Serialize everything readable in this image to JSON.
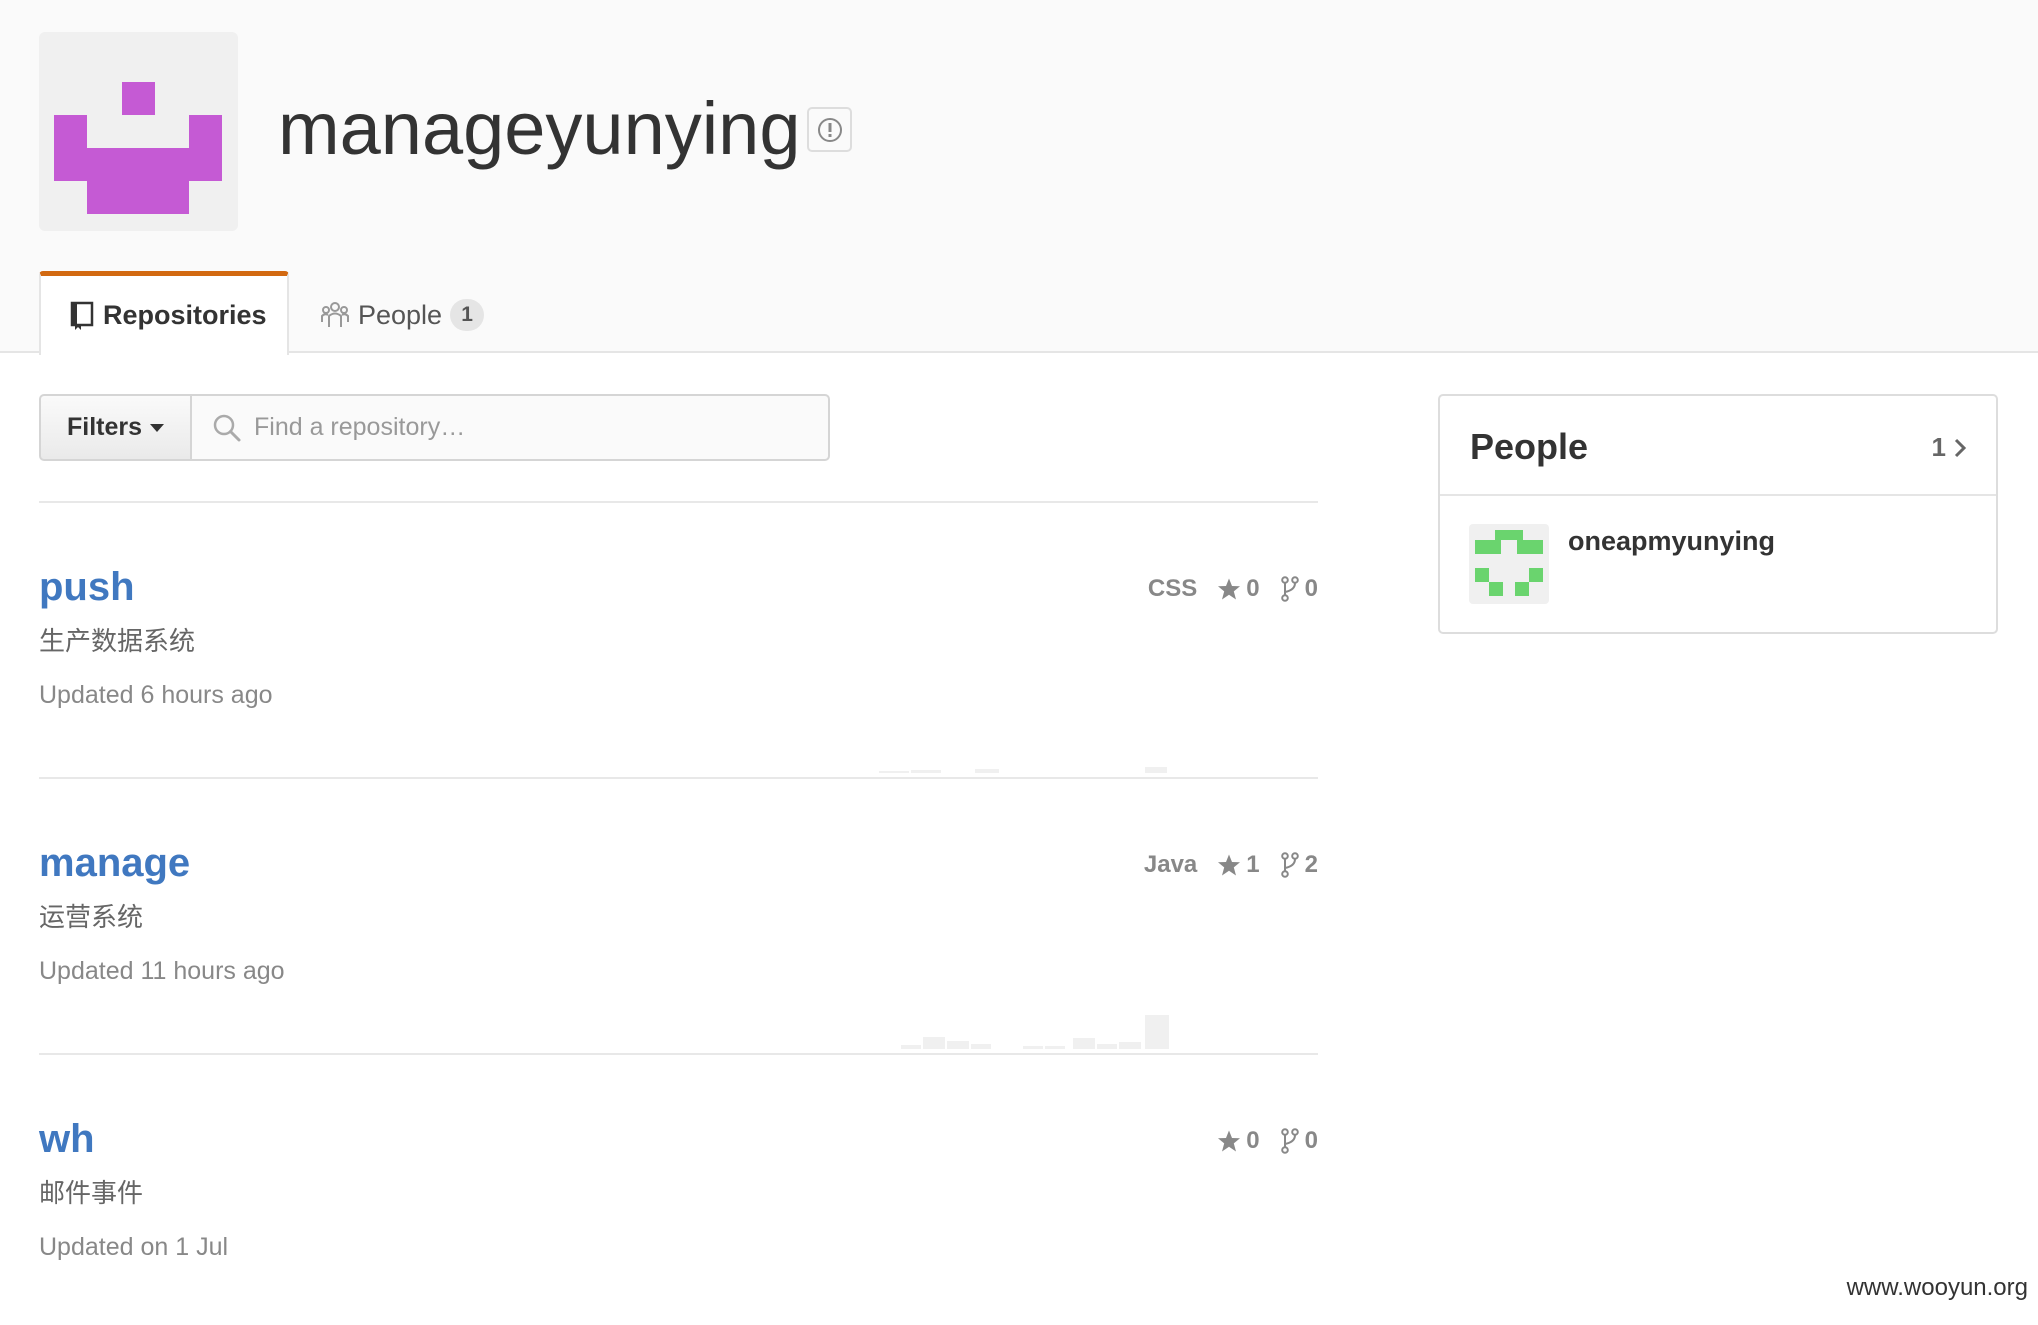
{
  "org": {
    "name": "manageyunying",
    "avatar_color": "#c55ad4"
  },
  "tabs": {
    "repositories_label": "Repositories",
    "people_label": "People",
    "people_count": "1",
    "active_color": "#d26911"
  },
  "filters": {
    "button_label": "Filters",
    "search_placeholder": "Find a repository…"
  },
  "repos": [
    {
      "name": "push",
      "description": "生产数据系统",
      "updated": "Updated 6 hours ago",
      "language": "CSS",
      "stars": "0",
      "forks": "0"
    },
    {
      "name": "manage",
      "description": "运营系统",
      "updated": "Updated 11 hours ago",
      "language": "Java",
      "stars": "1",
      "forks": "2"
    },
    {
      "name": "wh",
      "description": "邮件事件",
      "updated": "Updated on 1 Jul",
      "language": "",
      "stars": "0",
      "forks": "0"
    }
  ],
  "people_panel": {
    "title": "People",
    "count": "1",
    "members": [
      {
        "login": "oneapmyunying",
        "avatar_color": "#6ad46e"
      }
    ]
  },
  "watermark": "www.wooyun.org",
  "colors": {
    "link": "#4078c0",
    "muted": "#888888"
  }
}
